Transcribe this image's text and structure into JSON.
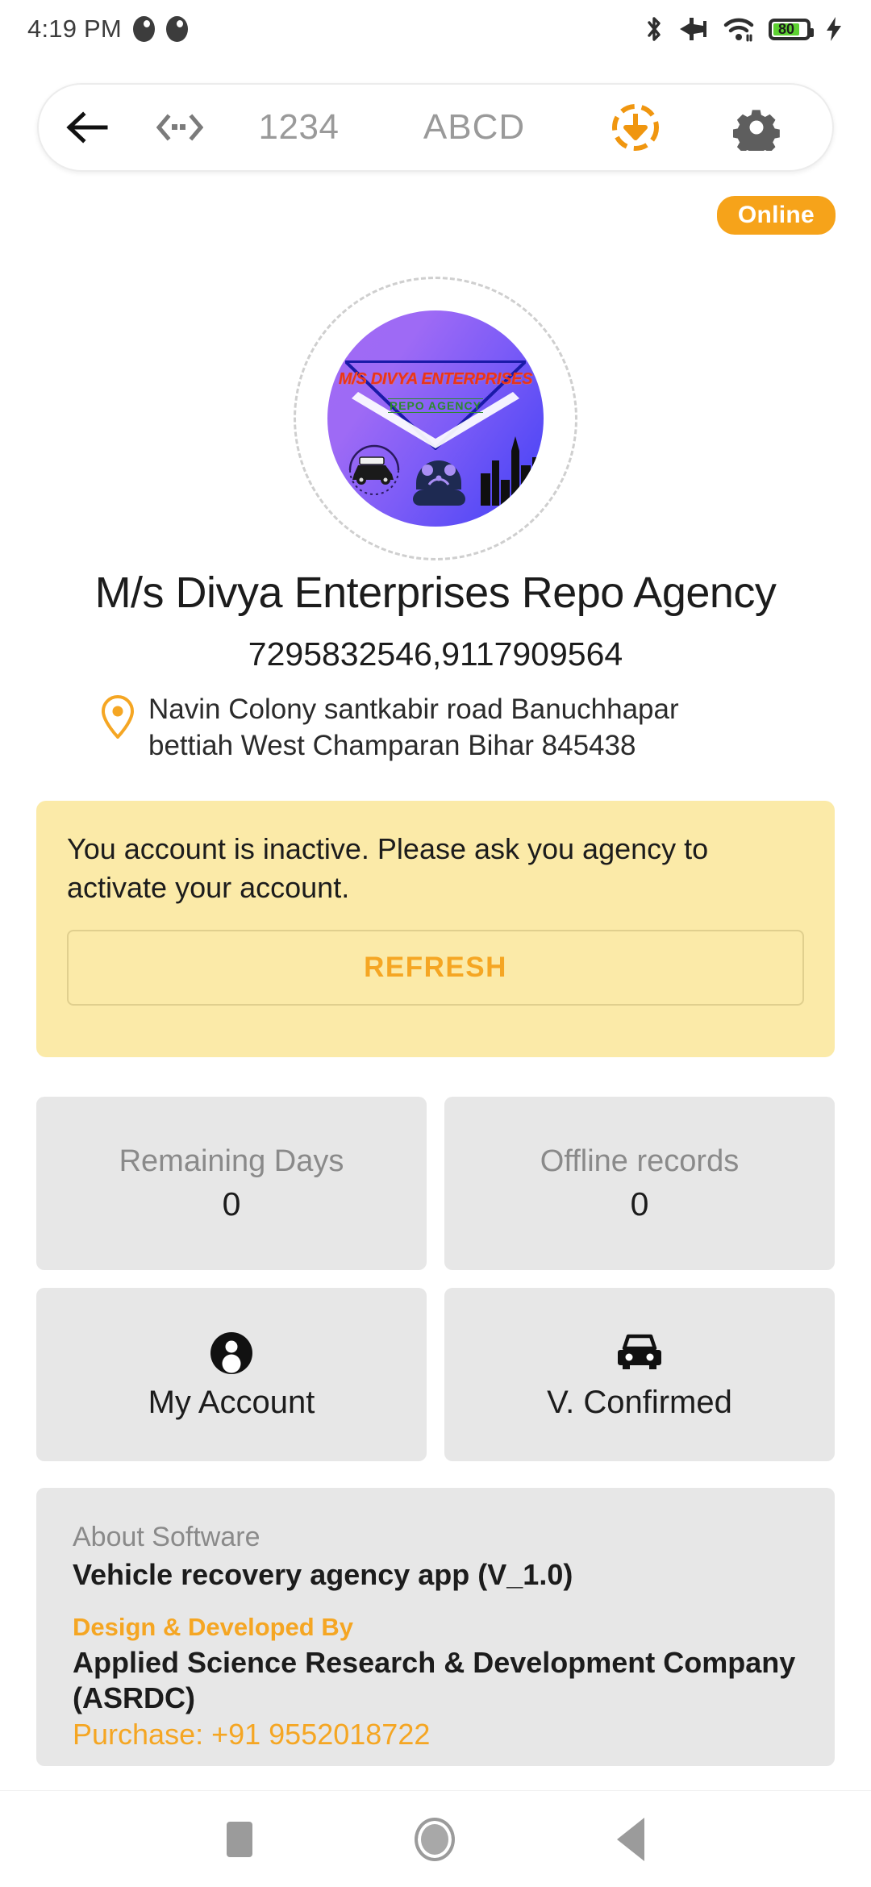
{
  "status_bar": {
    "time": "4:19 PM",
    "left_icons": [
      "dnd-icon",
      "dnd-icon"
    ],
    "right_icons": [
      "bluetooth-icon",
      "airplane-mode-icon",
      "wifi-icon",
      "battery-icon",
      "charging-bolt-icon"
    ],
    "battery_percent": "80",
    "battery_fill_color": "#5dd131"
  },
  "toolbar": {
    "back_icon": "back-arrow-icon",
    "code_icon": "chevron-dots-icon",
    "numeric_field": "1234",
    "alpha_field": "ABCD",
    "download_icon": "download-sync-icon",
    "settings_icon": "gear-icon",
    "download_color": "#f0960f",
    "gear_color": "#5e5e5e"
  },
  "connection": {
    "badge_label": "Online",
    "badge_color": "#f6a31a"
  },
  "logo": {
    "brand_text": "M/S DIVYA ENTERPRISES",
    "sub_text": "REPO AGENCY",
    "icons": [
      "classic-car-icon",
      "wrench-gear-icon",
      "city-skyline-icon"
    ],
    "gradient_start": "#a06bf5",
    "gradient_end": "#4040f5"
  },
  "agency": {
    "title": "M/s Divya Enterprises Repo Agency",
    "phones": "7295832546,9117909564",
    "address_icon": "location-pin-icon",
    "address": "Navin Colony santkabir road Banuchhapar bettiah West Champaran Bihar 845438"
  },
  "alert": {
    "message": "You account is inactive. Please ask you agency to activate your account.",
    "button_label": "REFRESH",
    "background": "#fbeaa8",
    "button_color": "#f5a623"
  },
  "tiles": [
    {
      "name": "remaining-days",
      "label": "Remaining Days",
      "value": "0",
      "kind": "stat"
    },
    {
      "name": "offline-records",
      "label": "Offline records",
      "value": "0",
      "kind": "stat"
    },
    {
      "name": "my-account",
      "label": "My Account",
      "icon": "person-icon",
      "kind": "action"
    },
    {
      "name": "vehicle-confirmed",
      "label": "V. Confirmed",
      "icon": "car-icon",
      "kind": "action"
    }
  ],
  "about": {
    "heading": "About Software",
    "app_name": "Vehicle recovery agency app (V_1.0)",
    "developed_by_label": "Design & Developed By",
    "company": "Applied Science Research & Development Company (ASRDC)",
    "purchase": "Purchase: +91 9552018722",
    "accent_color": "#f5a623"
  },
  "navbar": {
    "recents_icon": "square-recents-icon",
    "home_icon": "circle-home-icon",
    "back_icon": "triangle-back-icon"
  }
}
